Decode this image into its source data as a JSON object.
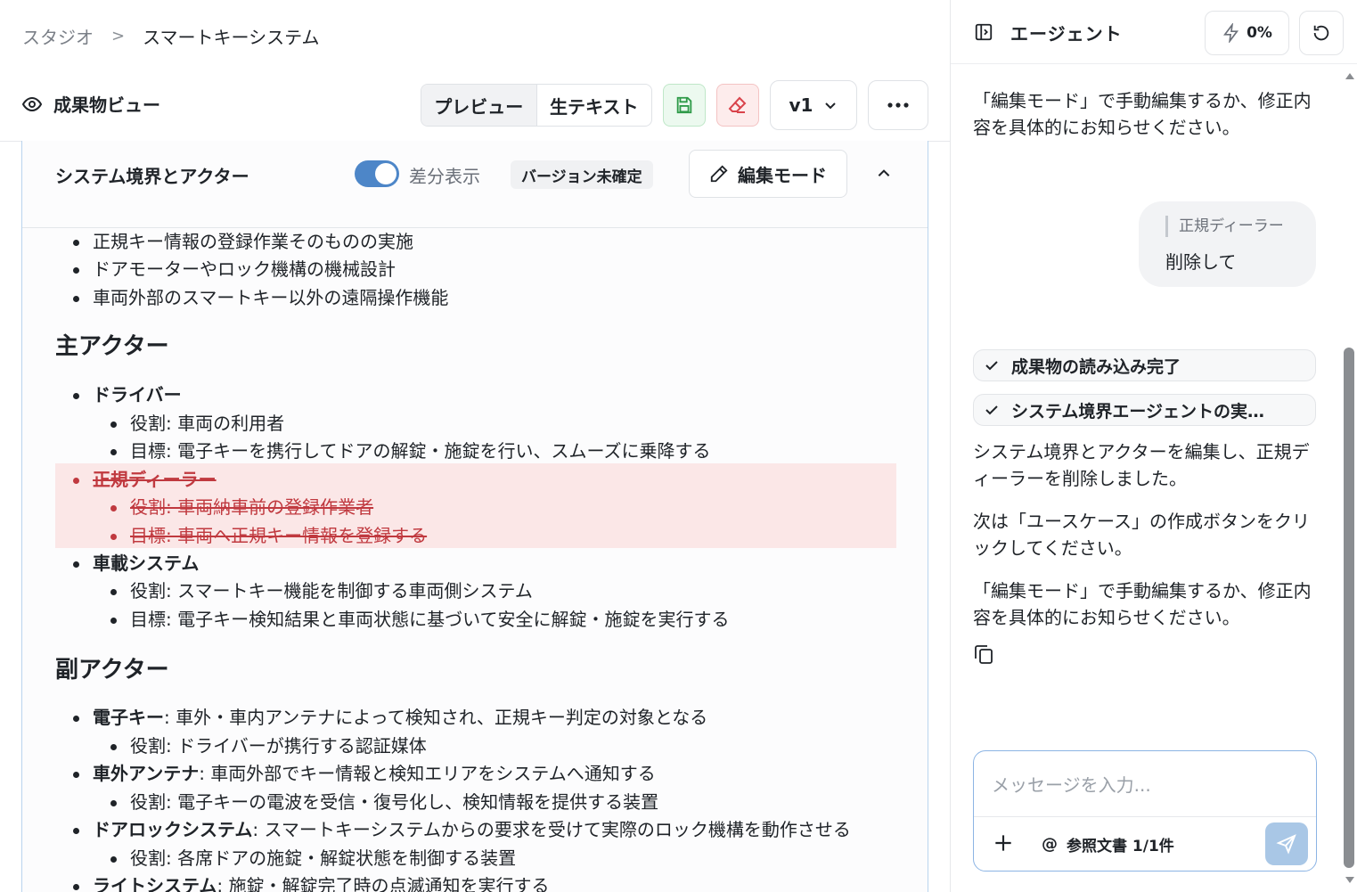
{
  "breadcrumb": {
    "root": "スタジオ",
    "separator": ">",
    "current": "スマートキーシステム"
  },
  "toolbar": {
    "view_title": "成果物ビュー",
    "tab_preview": "プレビュー",
    "tab_raw": "生テキスト",
    "version": "v1",
    "colors": {
      "save": "#2e9a48",
      "erase": "#d9434b"
    }
  },
  "section": {
    "title": "システム境界とアクター",
    "diff_label": "差分表示",
    "diff_enabled": true,
    "badge": "バージョン未確定",
    "edit_label": "編集モード"
  },
  "content": {
    "out_of_scope": [
      "正規キー情報の登録作業そのものの実施",
      "ドアモーターやロック機構の機械設計",
      "車両外部のスマートキー以外の遠隔操作機能"
    ],
    "primary_heading": "主アクター",
    "driver": {
      "name": "ドライバー",
      "role": "役割: 車両の利用者",
      "goal": "目標: 電子キーを携行してドアの解錠・施錠を行い、スムーズに乗降する"
    },
    "dealer_deleted": {
      "name": "正規ディーラー",
      "role": "役割: 車両納車前の登録作業者",
      "goal": "目標: 車両へ正規キー情報を登録する"
    },
    "onboard": {
      "name": "車載システム",
      "role": "役割: スマートキー機能を制御する車両側システム",
      "goal": "目標: 電子キー検知結果と車両状態に基づいて安全に解錠・施錠を実行する"
    },
    "secondary_heading": "副アクター",
    "ekey": {
      "name": "電子キー",
      "desc": ": 車外・車内アンテナによって検知され、正規キー判定の対象となる",
      "role": "役割: ドライバーが携行する認証媒体"
    },
    "antenna": {
      "name": "車外アンテナ",
      "desc": ": 車両外部でキー情報と検知エリアをシステムへ通知する",
      "role": "役割: 電子キーの電波を受信・復号化し、検知情報を提供する装置"
    },
    "doorlock": {
      "name": "ドアロックシステム",
      "desc": ": スマートキーシステムからの要求を受けて実際のロック機構を動作させる",
      "role": "役割: 各席ドアの施錠・解錠状態を制御する装置"
    },
    "light": {
      "name": "ライトシステム",
      "desc": ": 施錠・解錠完了時の点滅通知を実行する"
    }
  },
  "agent": {
    "title": "エージェント",
    "usage": "0%",
    "msg_top": "「編集モード」で手動編集するか、修正内容を具体的にお知らせください。",
    "user_quote": "正規ディーラー",
    "user_text": "削除して",
    "status1": "成果物の読み込み完了",
    "status2": "システム境界エージェントの実…",
    "reply1": "システム境界とアクターを編集し、正規ディーラーを削除しました。",
    "reply2": "次は「ユースケース」の作成ボタンをクリックしてください。",
    "reply3": "「編集モード」で手動編集するか、修正内容を具体的にお知らせください。",
    "composer_placeholder": "メッセージを入力...",
    "ref_label": "参照文書 1/1件",
    "colors": {
      "send": "#a9c7e6",
      "composer_border": "#8cb4e4"
    }
  }
}
